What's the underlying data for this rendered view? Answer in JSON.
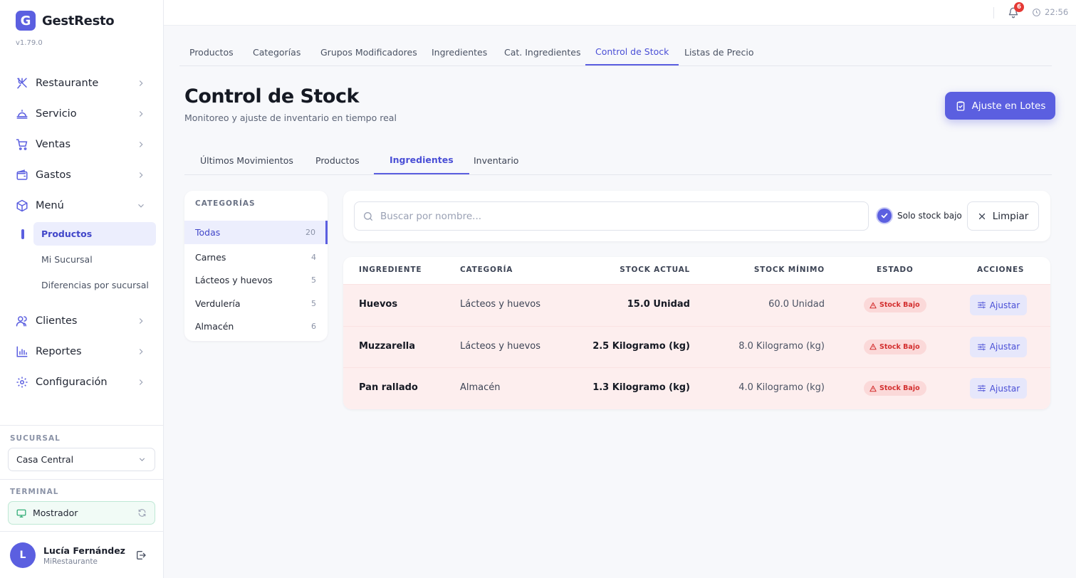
{
  "app": {
    "name": "GestResto",
    "logo_letter": "G",
    "version": "v1.79.0"
  },
  "sidebar": {
    "nav": [
      {
        "label": "Restaurante",
        "icon": "utensils-icon"
      },
      {
        "label": "Servicio",
        "icon": "cloche-icon"
      },
      {
        "label": "Ventas",
        "icon": "cart-icon"
      },
      {
        "label": "Gastos",
        "icon": "wallet-icon"
      },
      {
        "label": "Menú",
        "icon": "box-icon",
        "expanded": true
      }
    ],
    "menu_sub": [
      {
        "label": "Productos",
        "active": true
      },
      {
        "label": "Mi Sucursal"
      },
      {
        "label": "Diferencias por sucursal"
      }
    ],
    "nav_after": [
      {
        "label": "Clientes",
        "icon": "users-icon"
      },
      {
        "label": "Reportes",
        "icon": "bar-chart-icon"
      },
      {
        "label": "Configuración",
        "icon": "gear-icon"
      }
    ],
    "branch_caption": "SUCURSAL",
    "branch_value": "Casa Central",
    "terminal_caption": "TERMINAL",
    "terminal_value": "Mostrador",
    "user": {
      "initial": "L",
      "name": "Lucía Fernández",
      "org": "MiRestaurante"
    }
  },
  "topbar": {
    "notifications": "6",
    "time": "22:56"
  },
  "top_tabs": [
    "Productos",
    "Categorías",
    "Grupos Modificadores",
    "Ingredientes",
    "Cat. Ingredientes",
    "Control de Stock",
    "Listas de Precio"
  ],
  "top_tab_active": "Control de Stock",
  "page": {
    "title": "Control de Stock",
    "subtitle": "Monitoreo y ajuste de inventario en tiempo real",
    "batch_button": "Ajuste en Lotes"
  },
  "sub_tabs": [
    "Últimos Movimientos",
    "Productos",
    "Ingredientes",
    "Inventario"
  ],
  "sub_tab_active": "Ingredientes",
  "categories": {
    "heading": "CATEGORÍAS",
    "items": [
      {
        "label": "Todas",
        "count": "20",
        "active": true
      },
      {
        "label": "Carnes",
        "count": "4"
      },
      {
        "label": "Lácteos y huevos",
        "count": "5"
      },
      {
        "label": "Verdulería",
        "count": "5"
      },
      {
        "label": "Almacén",
        "count": "6"
      }
    ]
  },
  "filters": {
    "search_placeholder": "Buscar por nombre...",
    "search_value": "",
    "low_stock_label": "Solo stock bajo",
    "low_stock_checked": true,
    "clear_label": "Limpiar"
  },
  "table": {
    "headers": [
      "INGREDIENTE",
      "CATEGORÍA",
      "STOCK ACTUAL",
      "STOCK MÍNIMO",
      "ESTADO",
      "ACCIONES"
    ],
    "rows": [
      {
        "ingredient": "Huevos",
        "category": "Lácteos y huevos",
        "stock": "15.0 Unidad",
        "min": "60.0 Unidad",
        "status": "Stock Bajo",
        "action": "Ajustar"
      },
      {
        "ingredient": "Muzzarella",
        "category": "Lácteos y huevos",
        "stock": "2.5 Kilogramo (kg)",
        "min": "8.0 Kilogramo (kg)",
        "status": "Stock Bajo",
        "action": "Ajustar"
      },
      {
        "ingredient": "Pan rallado",
        "category": "Almacén",
        "stock": "1.3 Kilogramo (kg)",
        "min": "4.0 Kilogramo (kg)",
        "status": "Stock Bajo",
        "action": "Ajustar"
      }
    ]
  },
  "colors": {
    "accent": "#5b5fe0",
    "danger": "#d32f2f",
    "low_stock_row": "#fdeeee"
  }
}
